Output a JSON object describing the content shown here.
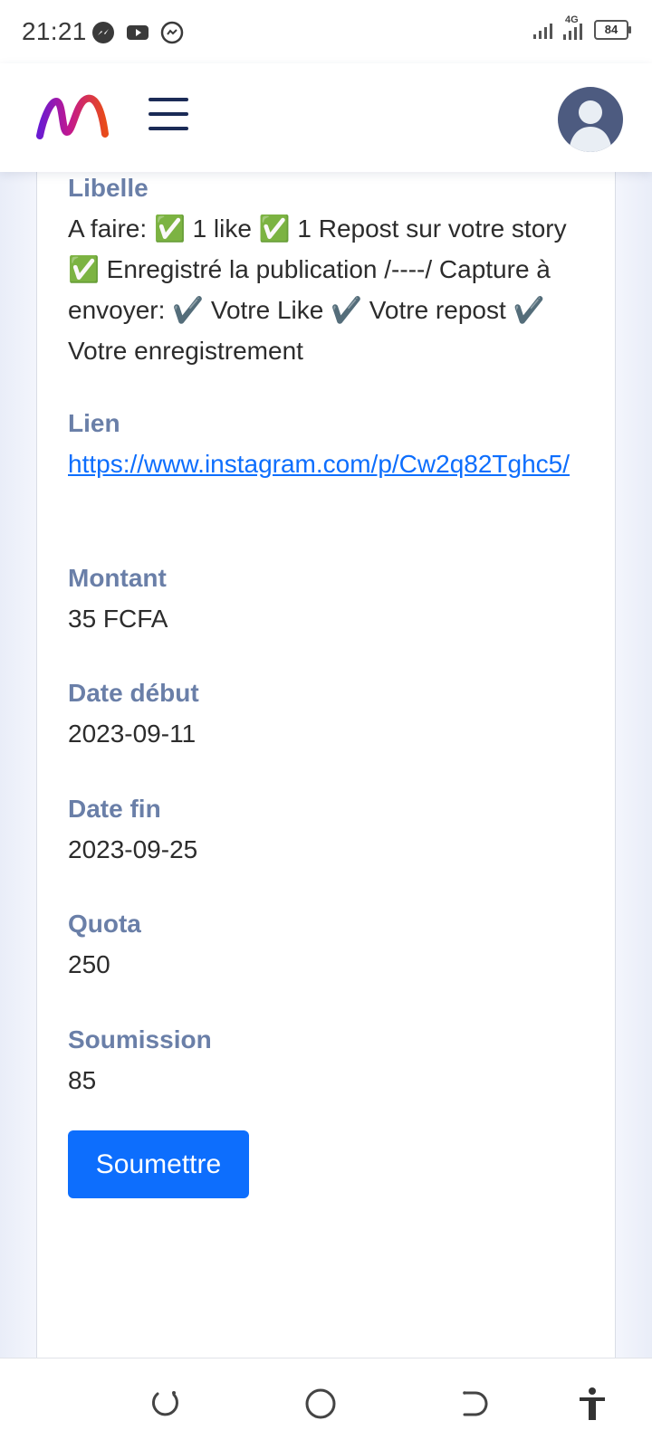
{
  "status_bar": {
    "time": "21:21",
    "network": "4G",
    "battery": "84",
    "app_icons": [
      "messenger-icon",
      "youtube-icon",
      "messenger-outline-icon"
    ]
  },
  "header": {
    "logo_icon": "brand-logo-icon",
    "menu_icon": "hamburger-menu-icon",
    "avatar_icon": "user-avatar-icon"
  },
  "details": {
    "libelle_label": "Libelle",
    "libelle_value": "A faire: ✅ 1 like ✅ 1 Repost sur votre story ✅ Enregistré la publication /----/ Capture à envoyer: ✔️ Votre Like ✔️ Votre repost ✔️ Votre enregistrement",
    "lien_label": "Lien",
    "lien_value": "https://www.instagram.com/p/Cw2q82Tghc5/",
    "montant_label": "Montant",
    "montant_value": "35 FCFA",
    "date_debut_label": "Date début",
    "date_debut_value": "2023-09-11",
    "date_fin_label": "Date fin",
    "date_fin_value": "2023-09-25",
    "quota_label": "Quota",
    "quota_value": "250",
    "soumission_label": "Soumission",
    "soumission_value": "85",
    "submit_label": "Soumettre"
  },
  "colors": {
    "accent": "#0d6efd",
    "label": "#6a7fa8",
    "header_nav": "#1b2b56"
  },
  "nav_bar": {
    "icons": [
      "recents-icon",
      "home-icon",
      "back-icon",
      "accessibility-icon"
    ]
  }
}
